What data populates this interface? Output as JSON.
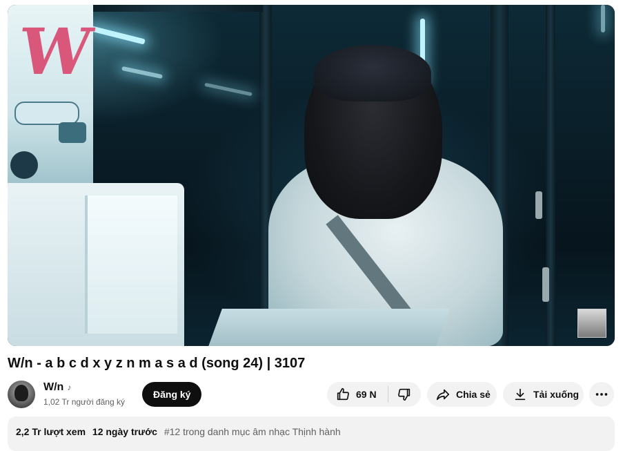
{
  "video": {
    "title": "W/n - a b c d x y z n m a s a d (song 24) | 3107"
  },
  "channel": {
    "name": "W/n",
    "subscribers": "1,02 Tr người đăng ký",
    "subscribe_label": "Đăng ký",
    "verified_icon": "music-note-icon"
  },
  "actions": {
    "like_count": "69 N",
    "share_label": "Chia sẻ",
    "download_label": "Tải xuống",
    "more_icon": "more-horizontal-icon"
  },
  "description": {
    "views": "2,2 Tr lượt xem",
    "date": "12 ngày trước",
    "trending": "#12 trong danh mục âm nhạc Thịnh hành"
  },
  "colors": {
    "subscribe_bg": "#0f0f0f",
    "pill_bg": "#f2f2f2",
    "muted_text": "#606060"
  }
}
